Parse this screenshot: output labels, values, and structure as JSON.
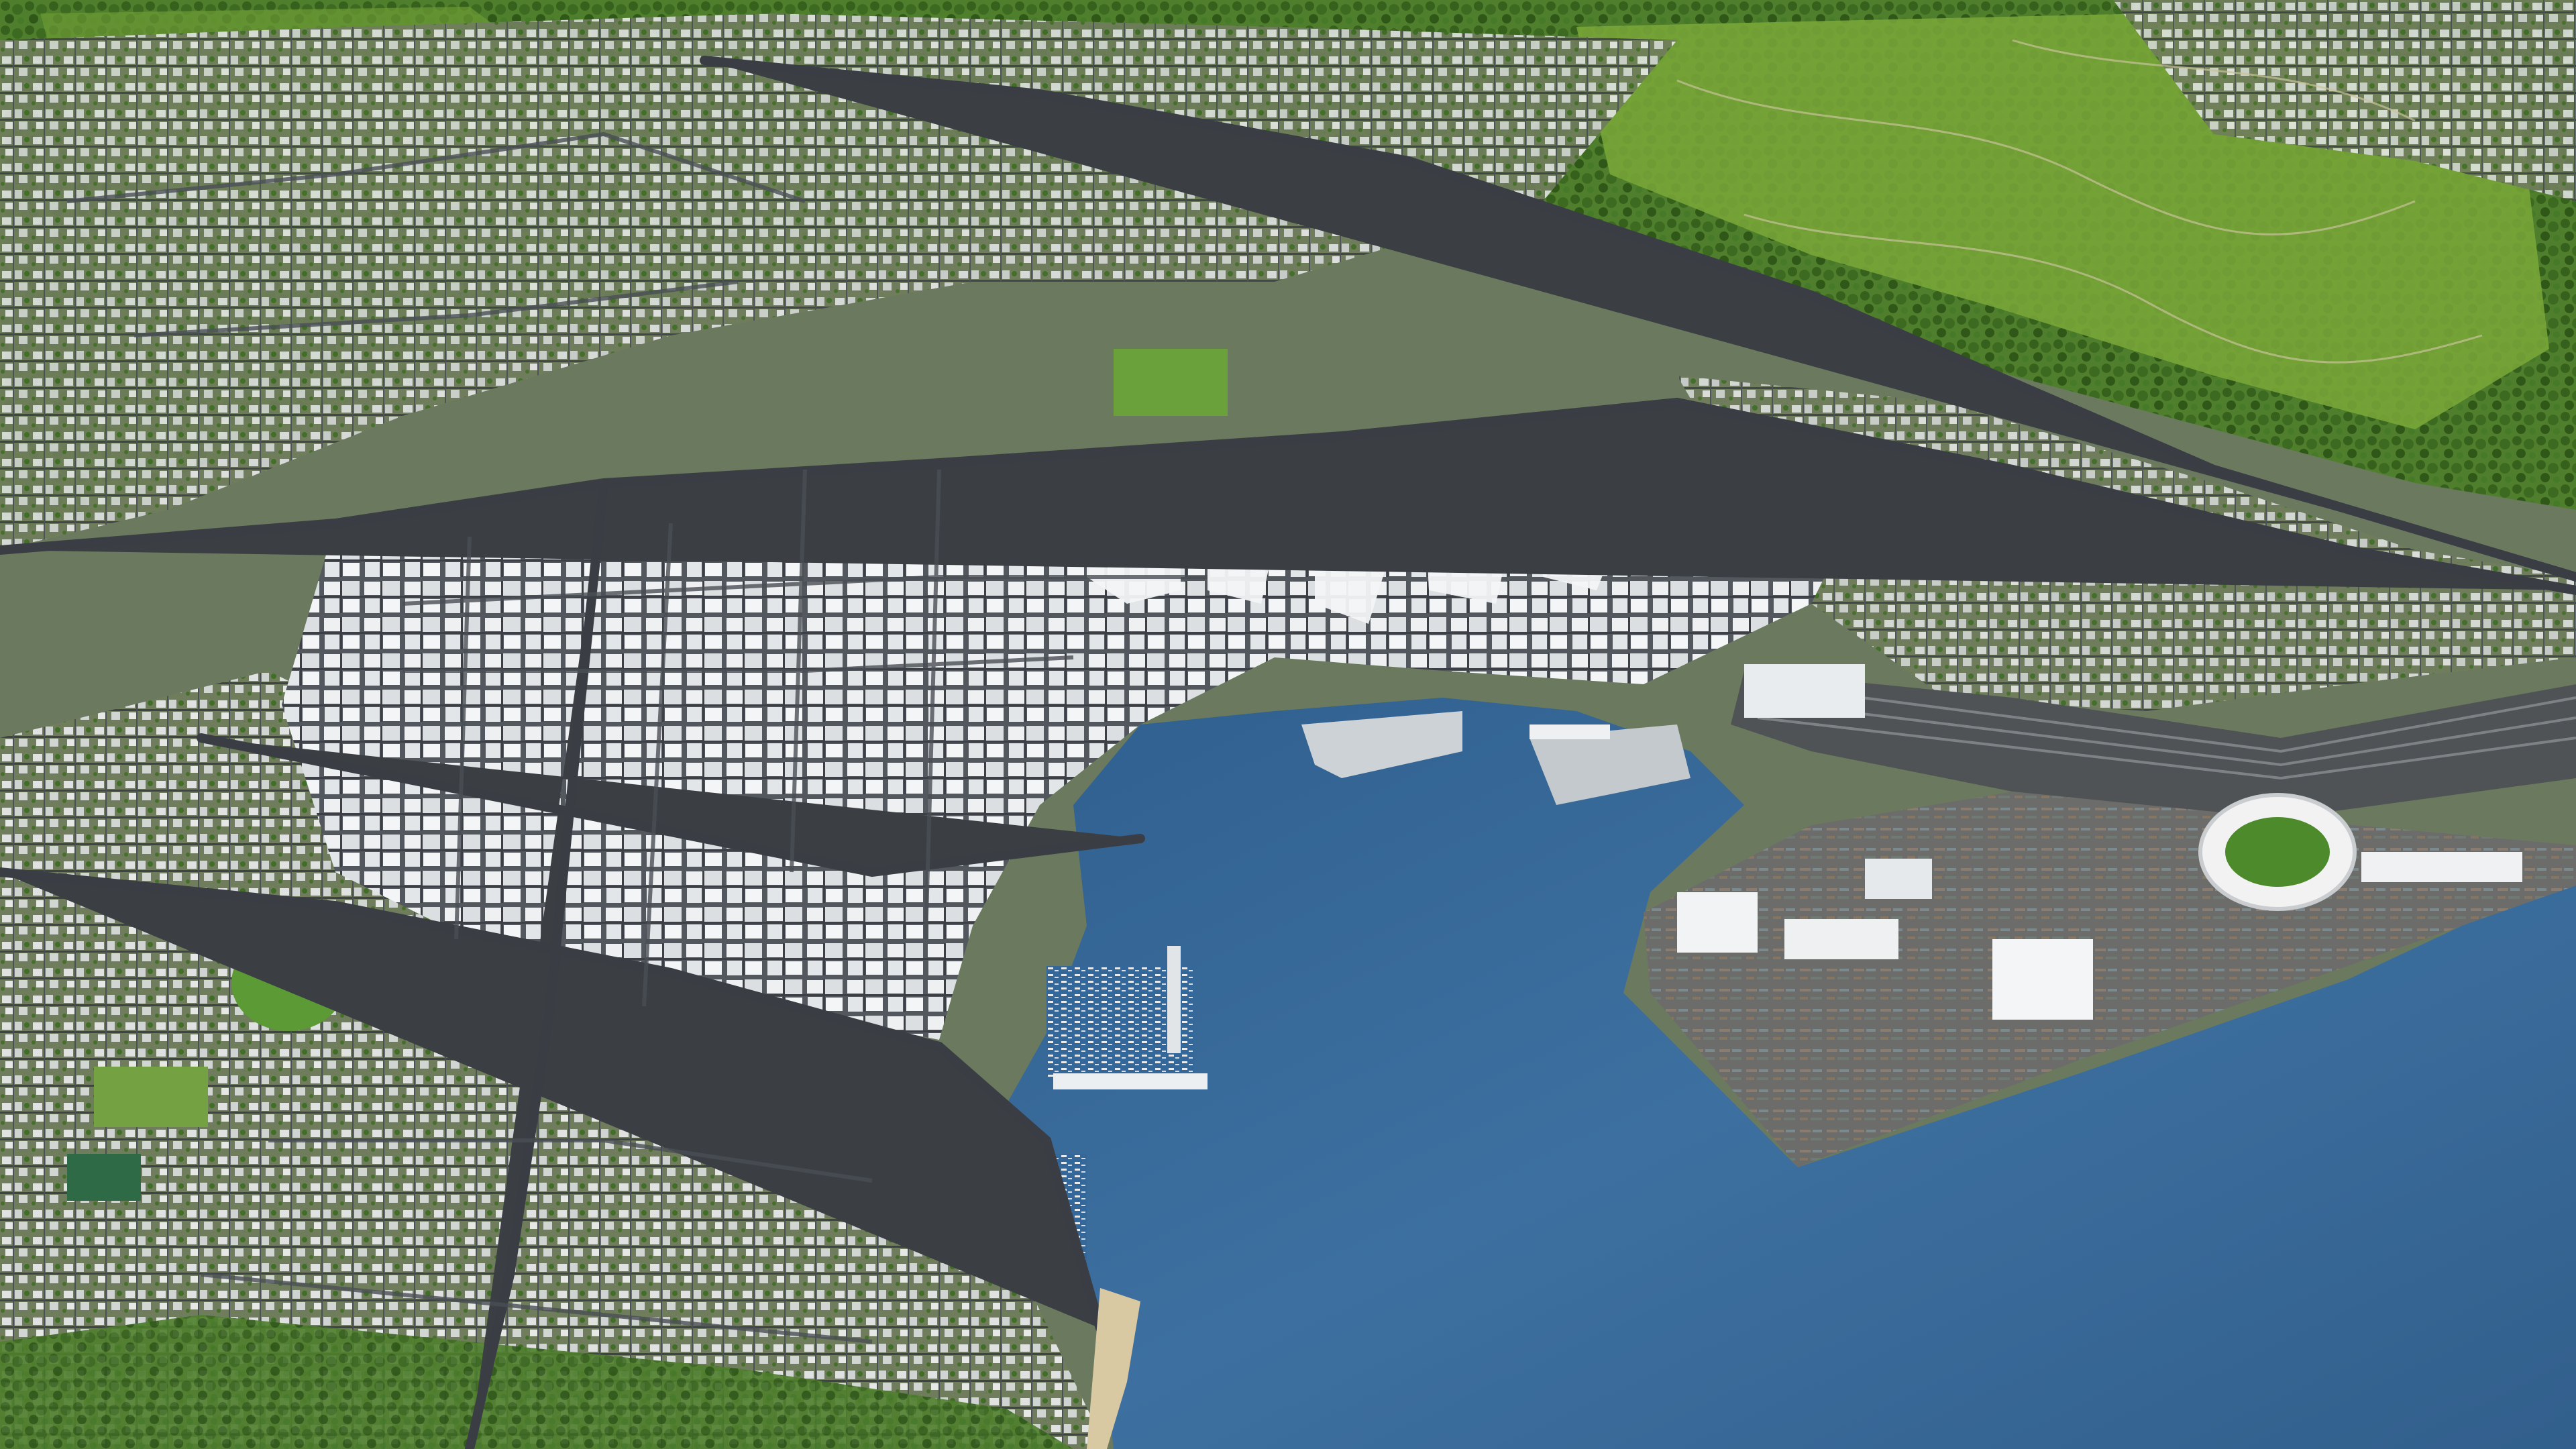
{
  "scene": {
    "kind": "3D aerial city model render",
    "text_labels": [],
    "regions": [
      {
        "name": "harbour-water",
        "color": "#3a6d9c"
      },
      {
        "name": "hillside-vegetation",
        "color": "#4f7f2c"
      },
      {
        "name": "open-grassland",
        "color": "#7aa83a"
      },
      {
        "name": "dense-cbd-buildings",
        "color": "#e9ecef"
      },
      {
        "name": "residential-suburbs",
        "color": "#8f948f"
      },
      {
        "name": "port-container-terminal",
        "color": "#6e6f6c"
      },
      {
        "name": "stadium",
        "color": "#f2f2f2"
      },
      {
        "name": "sports-oval",
        "color": "#5c9a35"
      },
      {
        "name": "marina",
        "color": "#d8dde2"
      },
      {
        "name": "railway-yard",
        "color": "#4f5356"
      },
      {
        "name": "roads",
        "color": "#3b3f44"
      }
    ]
  }
}
